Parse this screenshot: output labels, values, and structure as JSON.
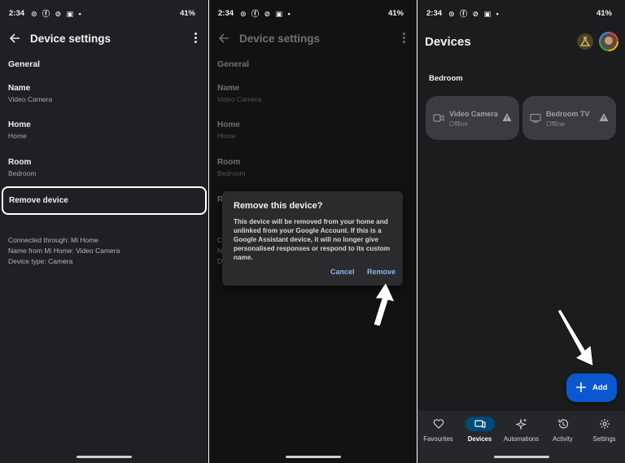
{
  "status_bar": {
    "time": "2:34",
    "notif_icons": "⊙ ⓕ ⊘ ▣ •",
    "signals": "▾◢ ",
    "battery": "41%"
  },
  "panel1": {
    "title": "Device settings",
    "section": "General",
    "rows": [
      {
        "label": "Name",
        "sub": "Video Camera"
      },
      {
        "label": "Home",
        "sub": "Home"
      },
      {
        "label": "Room",
        "sub": "Bedroom"
      }
    ],
    "remove_label": "Remove device",
    "info": [
      "Connected through: Mi Home",
      "Name from Mi Home: Video Camera",
      "Device type: Camera"
    ]
  },
  "panel2": {
    "dialog": {
      "title": "Remove this device?",
      "body": "This device will be removed from your home and unlinked from your Google Account. If this is a Google Assistant device, it will no longer give personalised responses or respond to its custom name.",
      "cancel": "Cancel",
      "remove": "Remove"
    },
    "peek_r": "R",
    "peek_c": "C\nN\nD"
  },
  "panel3": {
    "title": "Devices",
    "room": "Bedroom",
    "tiles": [
      {
        "name": "Video Camera",
        "status": "Offline",
        "icon": "camera-icon"
      },
      {
        "name": "Bedroom TV",
        "status": "Offline",
        "icon": "tv-icon"
      }
    ],
    "fab_label": "Add",
    "nav": [
      {
        "label": "Favourites",
        "icon": "heart-icon"
      },
      {
        "label": "Devices",
        "icon": "devices-icon",
        "active": true
      },
      {
        "label": "Automations",
        "icon": "sparkle-icon"
      },
      {
        "label": "Activity",
        "icon": "history-icon"
      },
      {
        "label": "Settings",
        "icon": "gear-icon"
      }
    ]
  },
  "colors": {
    "accent_blue": "#0b57d0",
    "link_blue": "#8ab4f8",
    "nav_active": "#004a77",
    "tile_bg": "#3b3c3f"
  }
}
